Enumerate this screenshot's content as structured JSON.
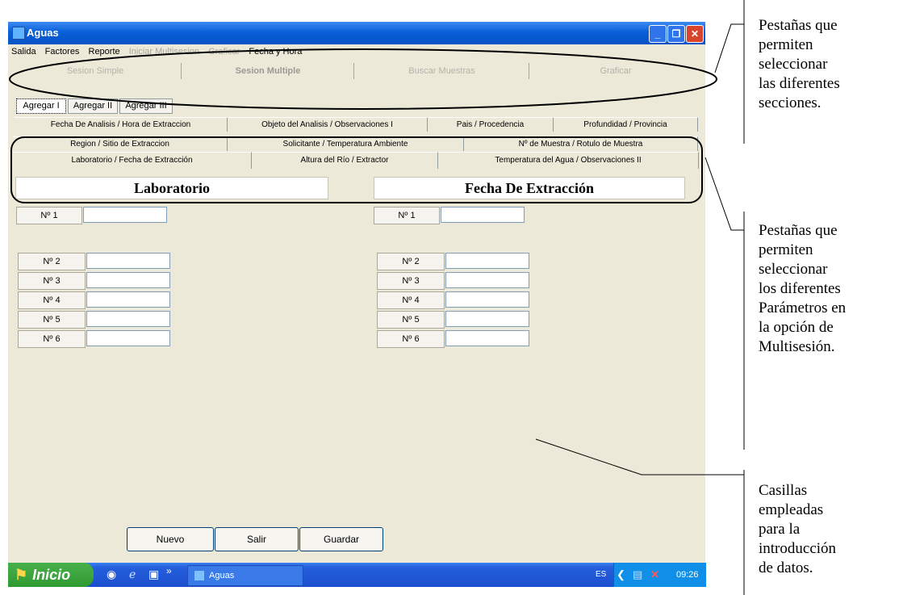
{
  "window": {
    "title": "Aguas"
  },
  "menu": [
    {
      "label": "Salida",
      "enabled": true
    },
    {
      "label": "Factores",
      "enabled": true
    },
    {
      "label": "Reporte",
      "enabled": true
    },
    {
      "label": "Iniciar Multisesion",
      "enabled": false
    },
    {
      "label": "Graficar",
      "enabled": false
    },
    {
      "label": "Fecha y Hora",
      "enabled": true
    }
  ],
  "session_tabs": [
    "Sesion Simple",
    "Sesion Multiple",
    "Buscar Muestras",
    "Graficar"
  ],
  "session_active": "Sesion Multiple",
  "agregar_tabs": [
    "Agregar I",
    "Agregar II",
    "Agregar III"
  ],
  "param_tabs": {
    "row1": [
      "Fecha De Analisis / Hora de Extraccion",
      "Objeto del Analisis / Observaciones I",
      "Pais / Procedencia",
      "Profundidad / Provincia"
    ],
    "row2": [
      "Region / Sitio de Extraccion",
      "Solicitante / Temperatura Ambiente",
      "Nº de Muestra / Rotulo de Muestra"
    ],
    "row3": [
      "Laboratorio / Fecha de Extracción",
      "Altura del Río / Extractor",
      "Temperatura del Agua / Observaciones II"
    ]
  },
  "sections": {
    "left_title": "Laboratorio",
    "right_title": "Fecha De Extracción"
  },
  "rows": [
    "Nº 1",
    "Nº 2",
    "Nº 3",
    "Nº 4",
    "Nº 5",
    "Nº 6"
  ],
  "buttons": {
    "nuevo": "Nuevo",
    "salir": "Salir",
    "guardar": "Guardar"
  },
  "taskbar": {
    "start": "Inicio",
    "task": "Aguas",
    "lang": "ES",
    "time": "09:26"
  },
  "annotations": {
    "a1": [
      "Pestañas que",
      "permiten",
      "seleccionar",
      "las diferentes",
      "secciones."
    ],
    "a2": [
      "Pestañas que",
      "permiten",
      "seleccionar",
      "los diferentes",
      "Parámetros en",
      "la opción de",
      "Multisesión."
    ],
    "a3": [
      "Casillas",
      "empleadas",
      "para la",
      "introducción",
      "de datos."
    ]
  }
}
